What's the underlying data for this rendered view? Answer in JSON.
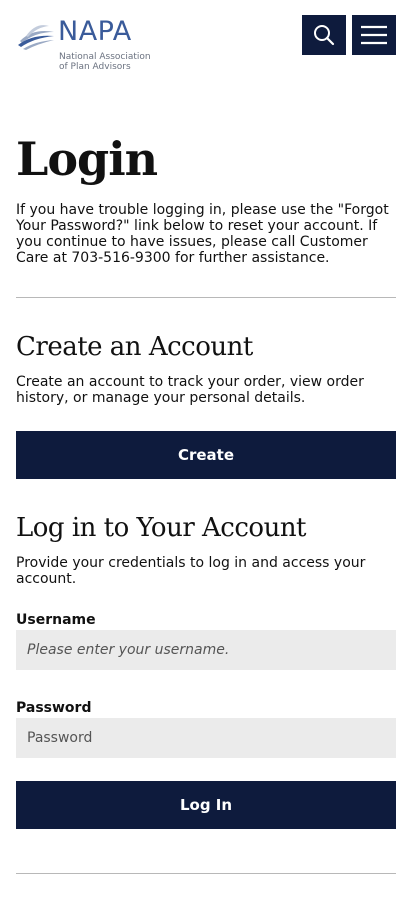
{
  "header": {
    "logo_word": "NAPA",
    "logo_sub_line1": "National Association",
    "logo_sub_line2": "of Plan Advisors",
    "search_icon": "search-icon",
    "menu_icon": "hamburger-menu-icon"
  },
  "page": {
    "title": "Login",
    "intro": "If you have trouble logging in, please use the \"Forgot Your Password?\" link below to reset your account. If you continue to have issues, please call Customer Care at 703-516-9300 for further assistance."
  },
  "create_section": {
    "title": "Create an Account",
    "text": "Create an account to track your order, view order history, or manage your personal details.",
    "button_label": "Create"
  },
  "login_section": {
    "title": "Log in to Your Account",
    "text": "Provide your credentials to log in and access your account.",
    "username_label": "Username",
    "username_value": "",
    "username_placeholder": "Please enter your username.",
    "password_label": "Password",
    "password_value": "",
    "password_placeholder": "Password",
    "button_label": "Log In"
  },
  "colors": {
    "navy": "#0e1b3d",
    "logo_blue": "#3a5b9a",
    "input_bg": "#ebebeb",
    "divider": "#b8b8b8"
  }
}
